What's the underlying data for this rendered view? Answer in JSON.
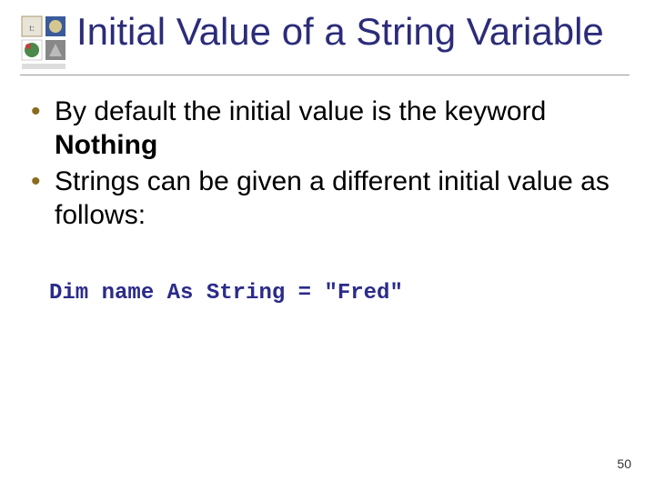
{
  "title": "Initial Value of a String Variable",
  "bullets": [
    {
      "pre": "By default the initial value is the keyword ",
      "kw": "Nothing",
      "post": ""
    },
    {
      "pre": "Strings can be given a different initial value as follows:",
      "kw": "",
      "post": ""
    }
  ],
  "code": "Dim name As String = \"Fred\"",
  "page_number": "50",
  "icon_name": "shapes-logo"
}
